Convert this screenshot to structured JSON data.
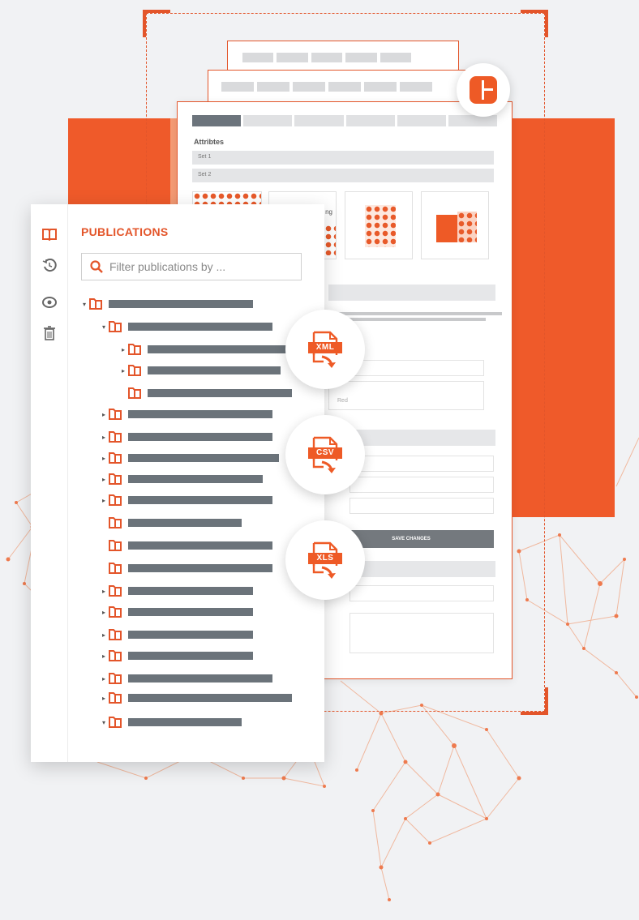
{
  "panel": {
    "title": "PUBLICATIONS",
    "search_placeholder": "Filter publications by ...",
    "rail_icons": [
      "book-icon",
      "history-icon",
      "eye-icon",
      "trash-icon"
    ]
  },
  "form": {
    "section_title": "Attribtes",
    "set1": "Set 1",
    "set2": "Set 2",
    "thumb_text": "ng",
    "select_value": "Red",
    "save_label": "SAVE CHANGES"
  },
  "exports": [
    "XML",
    "CSV",
    "XLS"
  ],
  "colors": {
    "accent": "#e3552a",
    "accent_fill": "#ef5a2a",
    "bar_gray": "#6b737a"
  }
}
